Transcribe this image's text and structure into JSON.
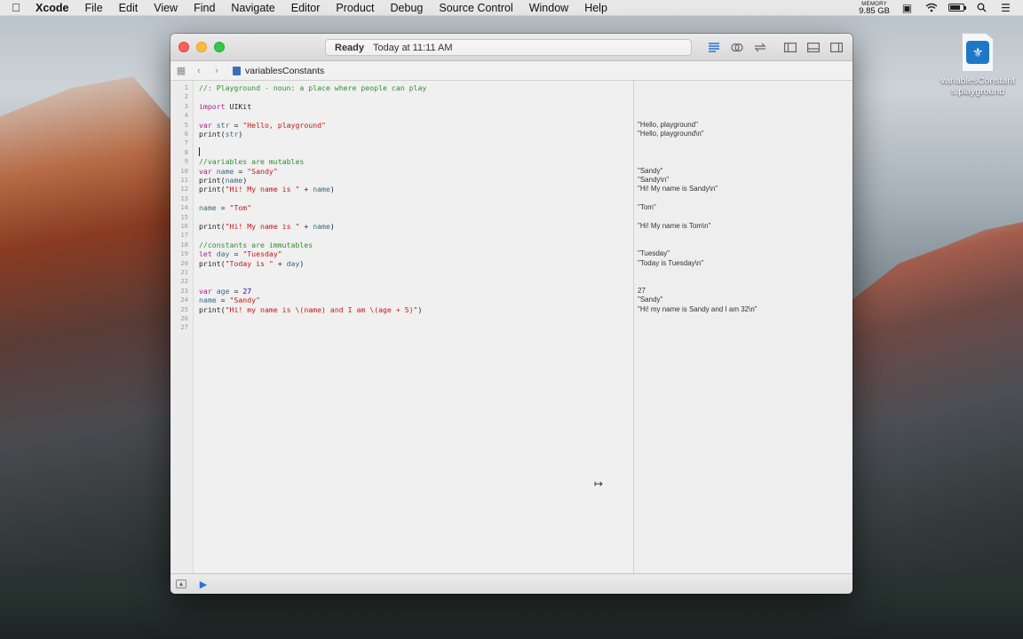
{
  "menubar": {
    "apple_icon": "apple-logo-icon",
    "items": [
      "Xcode",
      "File",
      "Edit",
      "View",
      "Find",
      "Navigate",
      "Editor",
      "Product",
      "Debug",
      "Source Control",
      "Window",
      "Help"
    ],
    "memory_label": "MEMORY",
    "memory_value": "9.85 GB"
  },
  "desktop": {
    "file_label": "variablesConstants.playground"
  },
  "window": {
    "activity_status": "Ready",
    "activity_time": "Today at 11:11 AM",
    "jumpbar_file": "variablesConstants"
  },
  "editor": {
    "lines": [
      {
        "n": "1",
        "code": "//: Playground - noun: a place where people can play",
        "result": ""
      },
      {
        "n": "2",
        "code": "",
        "result": ""
      },
      {
        "n": "3",
        "code": "import UIKit",
        "result": ""
      },
      {
        "n": "4",
        "code": "",
        "result": ""
      },
      {
        "n": "5",
        "code": "var str = \"Hello, playground\"",
        "result": "\"Hello, playground\""
      },
      {
        "n": "6",
        "code": "print(str)",
        "result": "\"Hello, playground\\n\""
      },
      {
        "n": "7",
        "code": "",
        "result": ""
      },
      {
        "n": "8",
        "code": "",
        "result": ""
      },
      {
        "n": "9",
        "code": "//variables are mutables",
        "result": ""
      },
      {
        "n": "10",
        "code": "var name = \"Sandy\"",
        "result": "\"Sandy\""
      },
      {
        "n": "11",
        "code": "print(name)",
        "result": "\"Sandy\\n\""
      },
      {
        "n": "12",
        "code": "print(\"Hi! My name is \" + name)",
        "result": "\"Hi! My name is Sandy\\n\""
      },
      {
        "n": "13",
        "code": "",
        "result": ""
      },
      {
        "n": "14",
        "code": "name = \"Tom\"",
        "result": "\"Tom\""
      },
      {
        "n": "15",
        "code": "",
        "result": ""
      },
      {
        "n": "16",
        "code": "print(\"Hi! My name is \" + name)",
        "result": "\"Hi! My name is Tom\\n\""
      },
      {
        "n": "17",
        "code": "",
        "result": ""
      },
      {
        "n": "18",
        "code": "//constants are immutables",
        "result": ""
      },
      {
        "n": "19",
        "code": "let day = \"Tuesday\"",
        "result": "\"Tuesday\""
      },
      {
        "n": "20",
        "code": "print(\"Today is \" + day)",
        "result": "\"Today is Tuesday\\n\""
      },
      {
        "n": "21",
        "code": "",
        "result": ""
      },
      {
        "n": "22",
        "code": "",
        "result": ""
      },
      {
        "n": "23",
        "code": "var age = 27",
        "result": "27"
      },
      {
        "n": "24",
        "code": "name = \"Sandy\"",
        "result": "\"Sandy\""
      },
      {
        "n": "25",
        "code": "print(\"Hi! my name is \\(name) and I am \\(age + 5)\")",
        "result": "\"Hi! my name is Sandy and I am 32\\n\""
      },
      {
        "n": "26",
        "code": "",
        "result": ""
      },
      {
        "n": "27",
        "code": "",
        "result": ""
      }
    ]
  },
  "colors": {
    "comment": "#2f8f2f",
    "keyword": "#b0208d",
    "string": "#c41a16",
    "number": "#1c00cf",
    "identifier": "#3a6a82",
    "plain": "#222222",
    "accent": "#2a72d8"
  }
}
